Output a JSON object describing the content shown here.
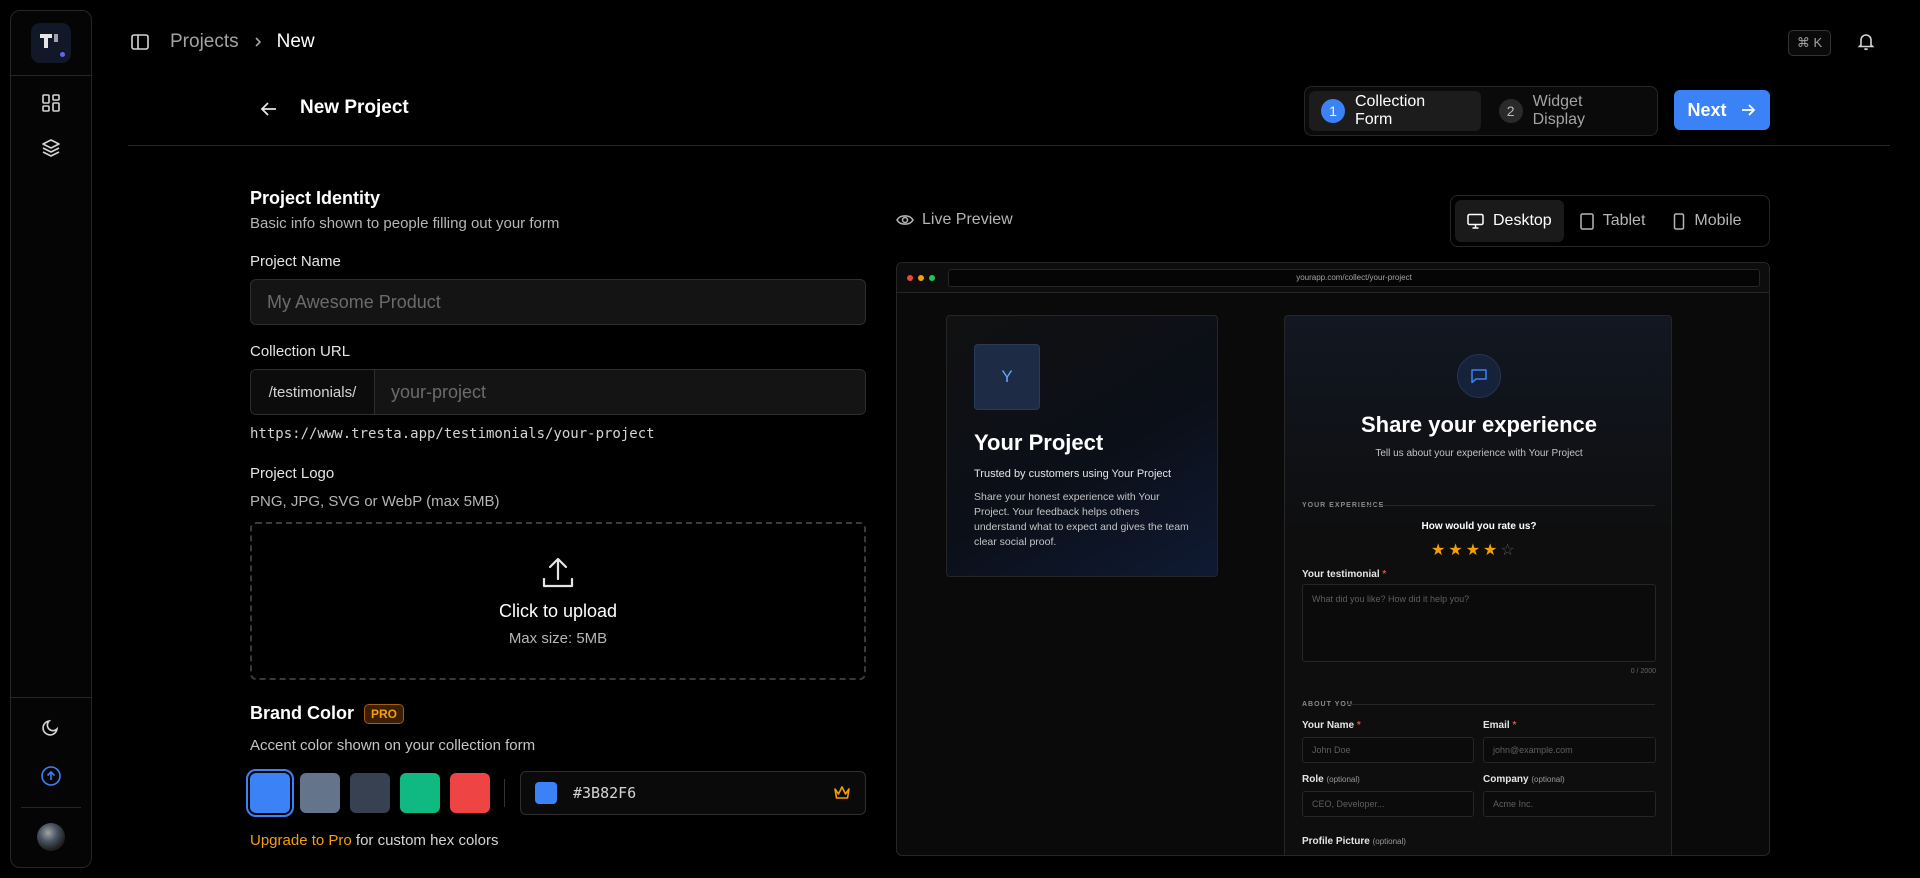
{
  "sidebar": {
    "logo_icon": "tresta-logo",
    "nav": [
      "dashboard-icon",
      "layers-icon"
    ],
    "bottom": [
      "moon-icon",
      "upgrade-icon"
    ],
    "avatar": "user-avatar"
  },
  "breadcrumb": {
    "parent": "Projects",
    "current": "New"
  },
  "topbar": {
    "shortcut": "⌘ K"
  },
  "header": {
    "title": "New Project",
    "steps": [
      {
        "num": "1",
        "label": "Collection Form",
        "active": true
      },
      {
        "num": "2",
        "label": "Widget Display",
        "active": false
      }
    ],
    "next_label": "Next"
  },
  "identity": {
    "title": "Project Identity",
    "desc": "Basic info shown to people filling out your form",
    "name_label": "Project Name",
    "name_placeholder": "My Awesome Product",
    "url_label": "Collection URL",
    "url_prefix": "/testimonials/",
    "url_placeholder": "your-project",
    "url_full": "https://www.tresta.app/testimonials/your-project",
    "logo_label": "Project Logo",
    "logo_hint": "PNG, JPG, SVG or WebP (max 5MB)",
    "upload_title": "Click to upload",
    "upload_size": "Max size: 5MB"
  },
  "brand": {
    "title": "Brand Color",
    "badge": "PRO",
    "desc": "Accent color shown on your collection form",
    "swatches": [
      "#3B82F6",
      "#64748B",
      "#374151",
      "#10B981",
      "#EF4444"
    ],
    "hex": "#3B82F6",
    "upgrade_link": "Upgrade to Pro",
    "upgrade_rest": " for custom hex colors"
  },
  "preview": {
    "label": "Live Preview",
    "devices": [
      {
        "label": "Desktop",
        "active": true
      },
      {
        "label": "Tablet",
        "active": false
      },
      {
        "label": "Mobile",
        "active": false
      }
    ],
    "url": "yourapp.com/collect/your-project",
    "left": {
      "initial": "Y",
      "title": "Your Project",
      "subtitle": "Trusted by customers using Your Project",
      "desc": "Share your honest experience with Your Project. Your feedback helps others understand what to expect and gives the team clear social proof."
    },
    "form": {
      "title": "Share your experience",
      "subtitle": "Tell us about your experience with Your Project",
      "sec_experience": "YOUR EXPERIENCE",
      "rate_q": "How would you rate us?",
      "rating": 4,
      "rating_max": 5,
      "testimonial_label": "Your testimonial",
      "testimonial_placeholder": "What did you like? How did it help you?",
      "counter": "0 / 2000",
      "sec_about": "ABOUT YOU",
      "name_label": "Your Name",
      "name_placeholder": "John Doe",
      "email_label": "Email",
      "email_placeholder": "john@example.com",
      "role_label": "Role",
      "role_placeholder": "CEO, Developer...",
      "company_label": "Company",
      "company_placeholder": "Acme Inc.",
      "optional": "(optional)",
      "picture_label": "Profile Picture",
      "required_mark": "*"
    }
  }
}
